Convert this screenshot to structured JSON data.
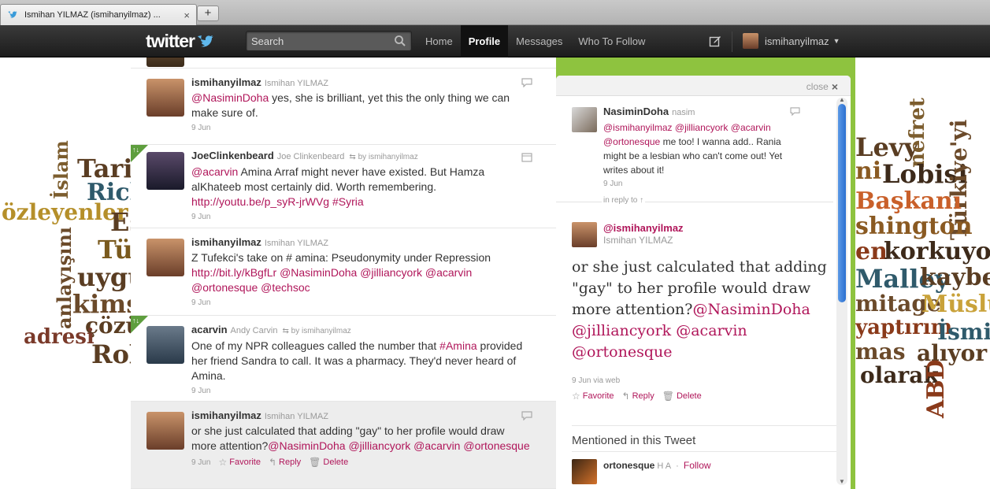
{
  "browser": {
    "tab_title": "Ismihan YILMAZ (ismihanyilmaz) ...",
    "new_tab": "+"
  },
  "topbar": {
    "logo": "twitter",
    "search_placeholder": "Search",
    "nav": [
      "Home",
      "Profile",
      "Messages",
      "Who To Follow"
    ],
    "active_nav": "Profile",
    "username": "ismihanyilmaz"
  },
  "timeline": {
    "tweets": [
      {
        "user": "ismihanyilmaz",
        "name": "Ismihan YILMAZ",
        "retweeted_by": "",
        "text_parts": [
          [
            "@NasiminDoha",
            "m"
          ],
          [
            " yes, she is brilliant, yet this the only thing we can make sure of.",
            ""
          ]
        ],
        "date": "9 Jun"
      },
      {
        "user": "JoeClinkenbeard",
        "name": "Joe Clinkenbeard",
        "retweeted_by": "by ismihanyilmaz",
        "text_parts": [
          [
            "@acarvin",
            "m"
          ],
          [
            " Amina Arraf might never have existed. But Hamza alKhateeb most certainly did. Worth remembering. ",
            ""
          ],
          [
            "http://youtu.be/p_syR-jrWVg",
            "m"
          ],
          [
            " ",
            ""
          ],
          [
            "#Syria",
            "m"
          ]
        ],
        "date": "9 Jun"
      },
      {
        "user": "ismihanyilmaz",
        "name": "Ismihan YILMAZ",
        "retweeted_by": "",
        "text_parts": [
          [
            "Z Tufekci's take on # amina: Pseudonymity under Repression ",
            ""
          ],
          [
            "http://bit.ly/kBgfLr",
            "m"
          ],
          [
            " ",
            ""
          ],
          [
            "@NasiminDoha",
            "m"
          ],
          [
            " ",
            ""
          ],
          [
            "@jilliancyork",
            "m"
          ],
          [
            " ",
            ""
          ],
          [
            "@acarvin",
            "m"
          ],
          [
            " ",
            ""
          ],
          [
            "@ortonesque",
            "m"
          ],
          [
            " ",
            ""
          ],
          [
            "@techsoc",
            "m"
          ]
        ],
        "date": "9 Jun"
      },
      {
        "user": "acarvin",
        "name": "Andy Carvin",
        "retweeted_by": "by ismihanyilmaz",
        "text_parts": [
          [
            "One of my NPR colleagues called the number that ",
            ""
          ],
          [
            "#Amina",
            "m"
          ],
          [
            " provided her friend Sandra to call. It was a pharmacy. They'd never heard of Amina.",
            ""
          ]
        ],
        "date": "9 Jun"
      },
      {
        "user": "ismihanyilmaz",
        "name": "Ismihan YILMAZ",
        "retweeted_by": "",
        "text_parts": [
          [
            "or she just calculated that adding \"gay\" to her profile would draw more attention?",
            ""
          ],
          [
            "@NasiminDoha",
            "m"
          ],
          [
            " ",
            ""
          ],
          [
            "@jilliancyork",
            "m"
          ],
          [
            " ",
            ""
          ],
          [
            "@acarvin",
            "m"
          ],
          [
            " ",
            ""
          ],
          [
            "@ortonesque",
            "m"
          ]
        ],
        "date": "9 Jun",
        "actions": [
          "Favorite",
          "Reply",
          "Delete"
        ]
      }
    ]
  },
  "details": {
    "close_label": "close",
    "context": {
      "user": "NasiminDoha",
      "name": "nasim",
      "text_parts": [
        [
          "@ismihanyilmaz",
          "m"
        ],
        [
          " ",
          ""
        ],
        [
          "@jilliancyork",
          "m"
        ],
        [
          " ",
          ""
        ],
        [
          "@acarvin",
          "m"
        ],
        [
          " ",
          ""
        ],
        [
          "@ortonesque",
          "m"
        ],
        [
          " me too! I wanna add.. Rania might be a lesbian who can't come out! Yet writes about it!",
          ""
        ]
      ],
      "date": "9 Jun"
    },
    "in_reply_to": "in reply to ↑",
    "main": {
      "user": "@ismihanyilmaz",
      "name": "Ismihan YILMAZ",
      "text_parts": [
        [
          "or she just calculated that adding \"gay\" to her profile would draw more attention?",
          ""
        ],
        [
          "@NasiminDoha",
          "m"
        ],
        [
          " ",
          ""
        ],
        [
          "@jilliancyork",
          "m"
        ],
        [
          " ",
          ""
        ],
        [
          "@acarvin",
          "m"
        ],
        [
          " ",
          ""
        ],
        [
          "@ortonesque",
          "m"
        ]
      ],
      "meta": "9 Jun via web",
      "actions": [
        "Favorite",
        "Reply",
        "Delete"
      ]
    },
    "mentioned_header": "Mentioned in this Tweet",
    "mention": {
      "user": "ortonesque",
      "name": "H A",
      "follow": "Follow"
    }
  },
  "wordcloud": {
    "left": [
      "özleyenler",
      "İslam",
      "Tarih",
      "Rich",
      "Es",
      "Tür",
      "anlayışını",
      "uygul",
      "kimse",
      "çözü",
      "adresi",
      "Rob"
    ],
    "right": [
      "Levy",
      "nefret",
      "ni",
      "Lobisi",
      "Türkiye'yi",
      "Başkanı",
      "shington",
      "en",
      "korkuyorla",
      "Malley",
      "kaybett",
      "mitage",
      "Müslü",
      "yaptırım",
      "İsmi",
      "mas",
      "alıyor",
      "olarak",
      "ABD"
    ]
  }
}
